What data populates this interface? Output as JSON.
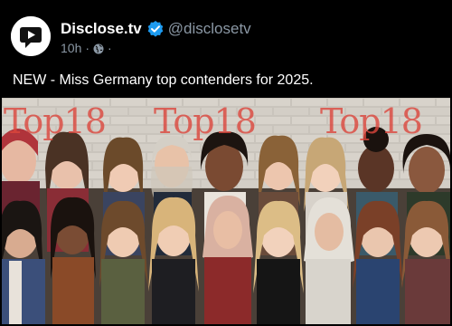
{
  "post": {
    "author": {
      "display_name": "Disclose.tv",
      "handle": "@disclosetv",
      "verified_icon": "verified-badge-icon",
      "avatar_icon": "play-logo-icon"
    },
    "meta": {
      "timestamp": "10h",
      "separator": "·",
      "visibility_icon": "globe-icon",
      "trailing": "·"
    },
    "text": "NEW - Miss Germany top contenders for 2025.",
    "media": {
      "description_icon": "group-photo",
      "overlay_text": [
        "Top18",
        "Top18",
        "Top18"
      ]
    }
  },
  "colors": {
    "background": "#000000",
    "text": "#ffffff",
    "muted": "#8b98a5",
    "verified": "#1d9bf0",
    "overlay": "#dc463c"
  }
}
